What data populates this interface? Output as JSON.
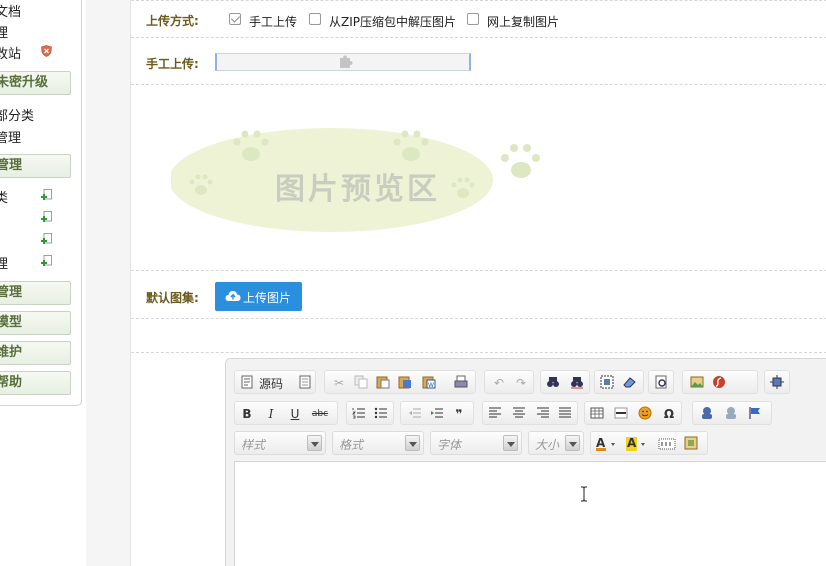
{
  "sidebar": {
    "items_top": [
      "文档",
      "理",
      "改站"
    ],
    "section_upgrade": "未密升级",
    "items_mid": [
      "部分类",
      "管理"
    ],
    "section_manage": "管理",
    "items_manage": [
      "类",
      "",
      "",
      "理"
    ],
    "sections_bottom": [
      "管理",
      "模型",
      "维护",
      "帮助"
    ]
  },
  "form": {
    "upload_method_label": "上传方式:",
    "options": [
      {
        "label": "手工上传",
        "checked": true
      },
      {
        "label": "从ZIP压缩包中解压图片",
        "checked": false
      },
      {
        "label": "网上复制图片",
        "checked": false
      }
    ],
    "manual_upload_label": "手工上传:",
    "preview_text": "图片预览区",
    "default_gallery_label": "默认图集:",
    "upload_button": "上传图片"
  },
  "editor": {
    "source_label": "源码",
    "bold": "B",
    "italic": "I",
    "underline": "U",
    "strike": "abc",
    "quote": "❞",
    "omega": "Ω",
    "style_placeholder": "样式",
    "format_placeholder": "格式",
    "font_placeholder": "字体",
    "size_placeholder": "大小"
  },
  "colors": {
    "accent": "#2b8fe0",
    "label": "#6b5a1e",
    "section_text": "#5a6e3b"
  }
}
